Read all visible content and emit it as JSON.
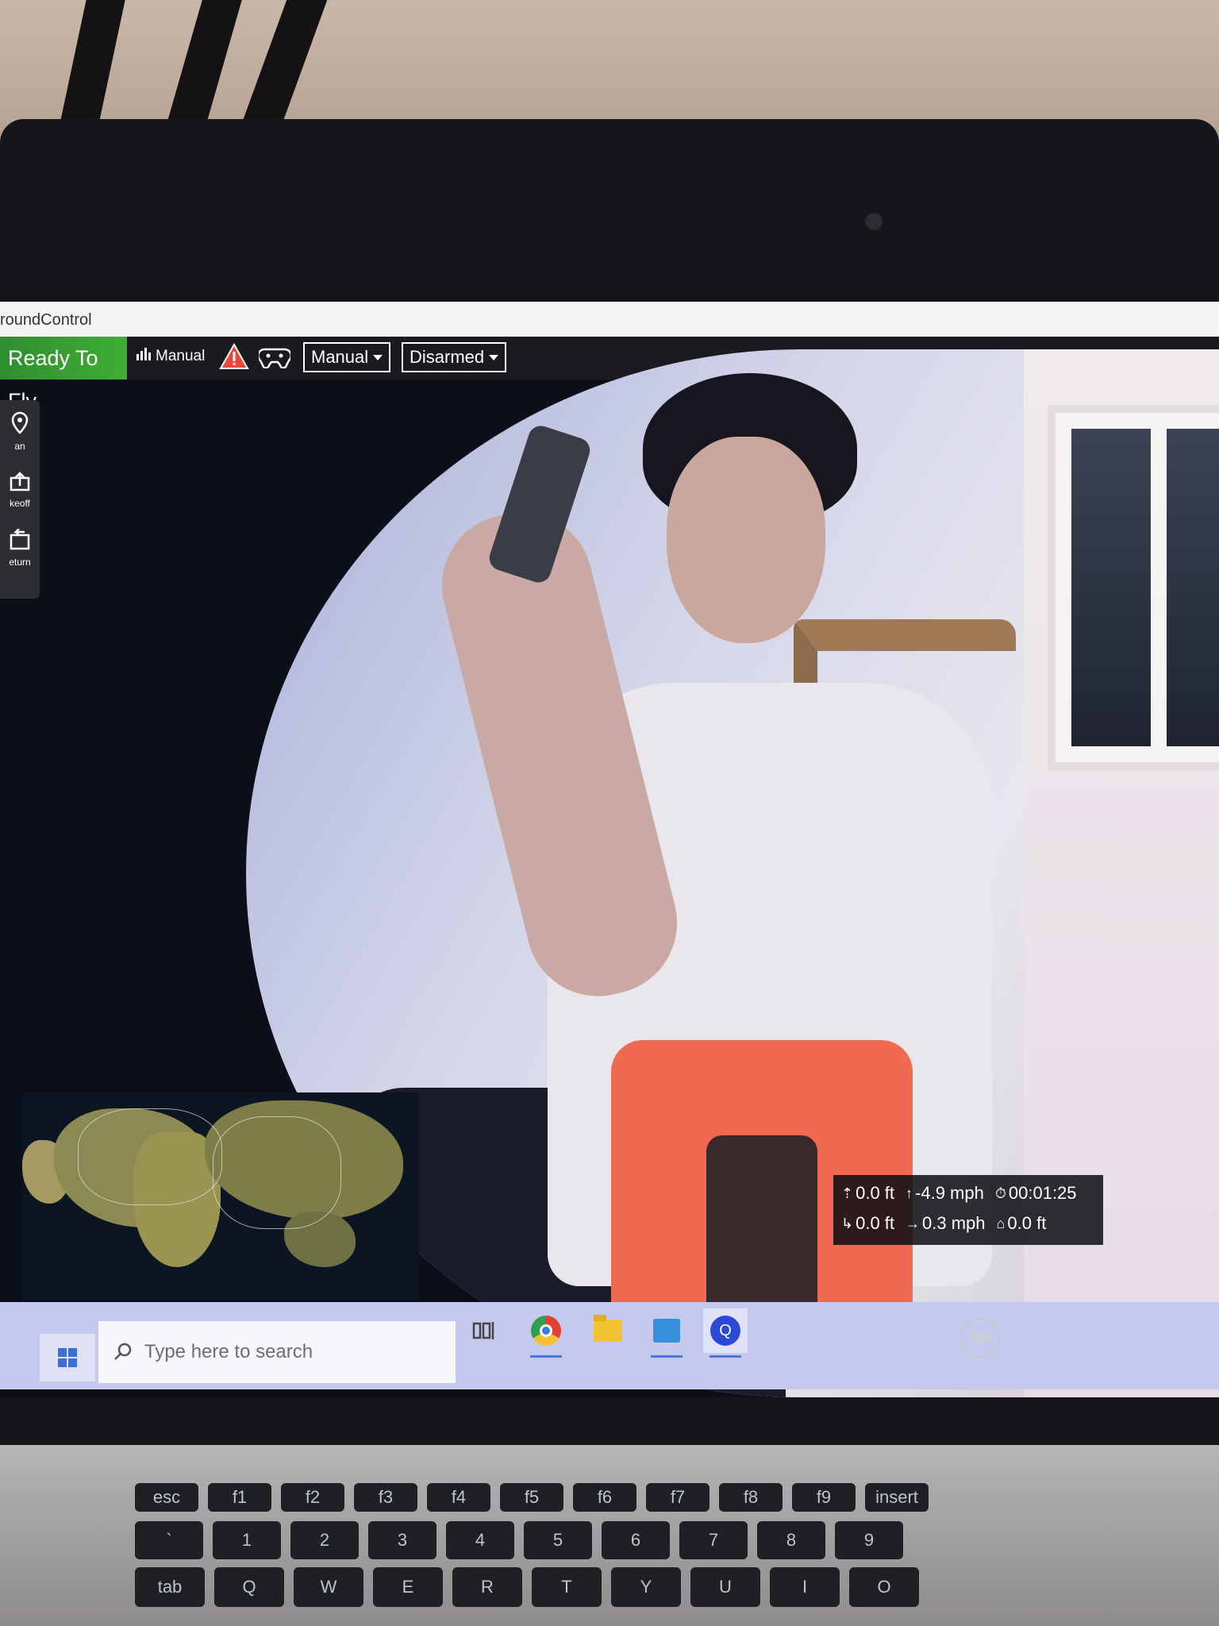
{
  "app": {
    "title": "roundControl"
  },
  "toolbar": {
    "status": "Ready To Fly",
    "mode_badge": "Manual",
    "flight_mode": "Manual",
    "arm_state": "Disarmed"
  },
  "toolstrip": {
    "items": [
      {
        "label": "an",
        "icon": "plan-icon"
      },
      {
        "label": "keoff",
        "icon": "takeoff-icon"
      },
      {
        "label": "eturn",
        "icon": "return-icon"
      }
    ]
  },
  "telemetry": {
    "altitude": "0.0 ft",
    "vertical_speed": "-4.9 mph",
    "flight_time": "00:01:25",
    "distance": "0.0 ft",
    "horizontal_speed": "0.3 mph",
    "home_distance": "0.0 ft"
  },
  "taskbar": {
    "search_placeholder": "Type here to search",
    "apps": [
      "task-view",
      "chrome",
      "file-explorer",
      "store",
      "qgroundcontrol"
    ]
  },
  "branding": {
    "laptop_logo": "hp"
  },
  "colors": {
    "ready_green": "#3fae34",
    "toolbar_bg": "#1b1b1f",
    "warning_red": "#e84a3a",
    "taskbar_bg": "#c5c9ee"
  },
  "keyboard": {
    "row1": [
      "esc",
      "f1",
      "f2",
      "f3",
      "f4",
      "f5",
      "f6",
      "f7",
      "f8",
      "f9",
      "insert"
    ],
    "row2": [
      "`",
      "1",
      "2",
      "3",
      "4",
      "5",
      "6",
      "7",
      "8",
      "9"
    ],
    "row3": [
      "tab",
      "Q",
      "W",
      "E",
      "R",
      "T",
      "Y",
      "U",
      "I",
      "O"
    ]
  }
}
